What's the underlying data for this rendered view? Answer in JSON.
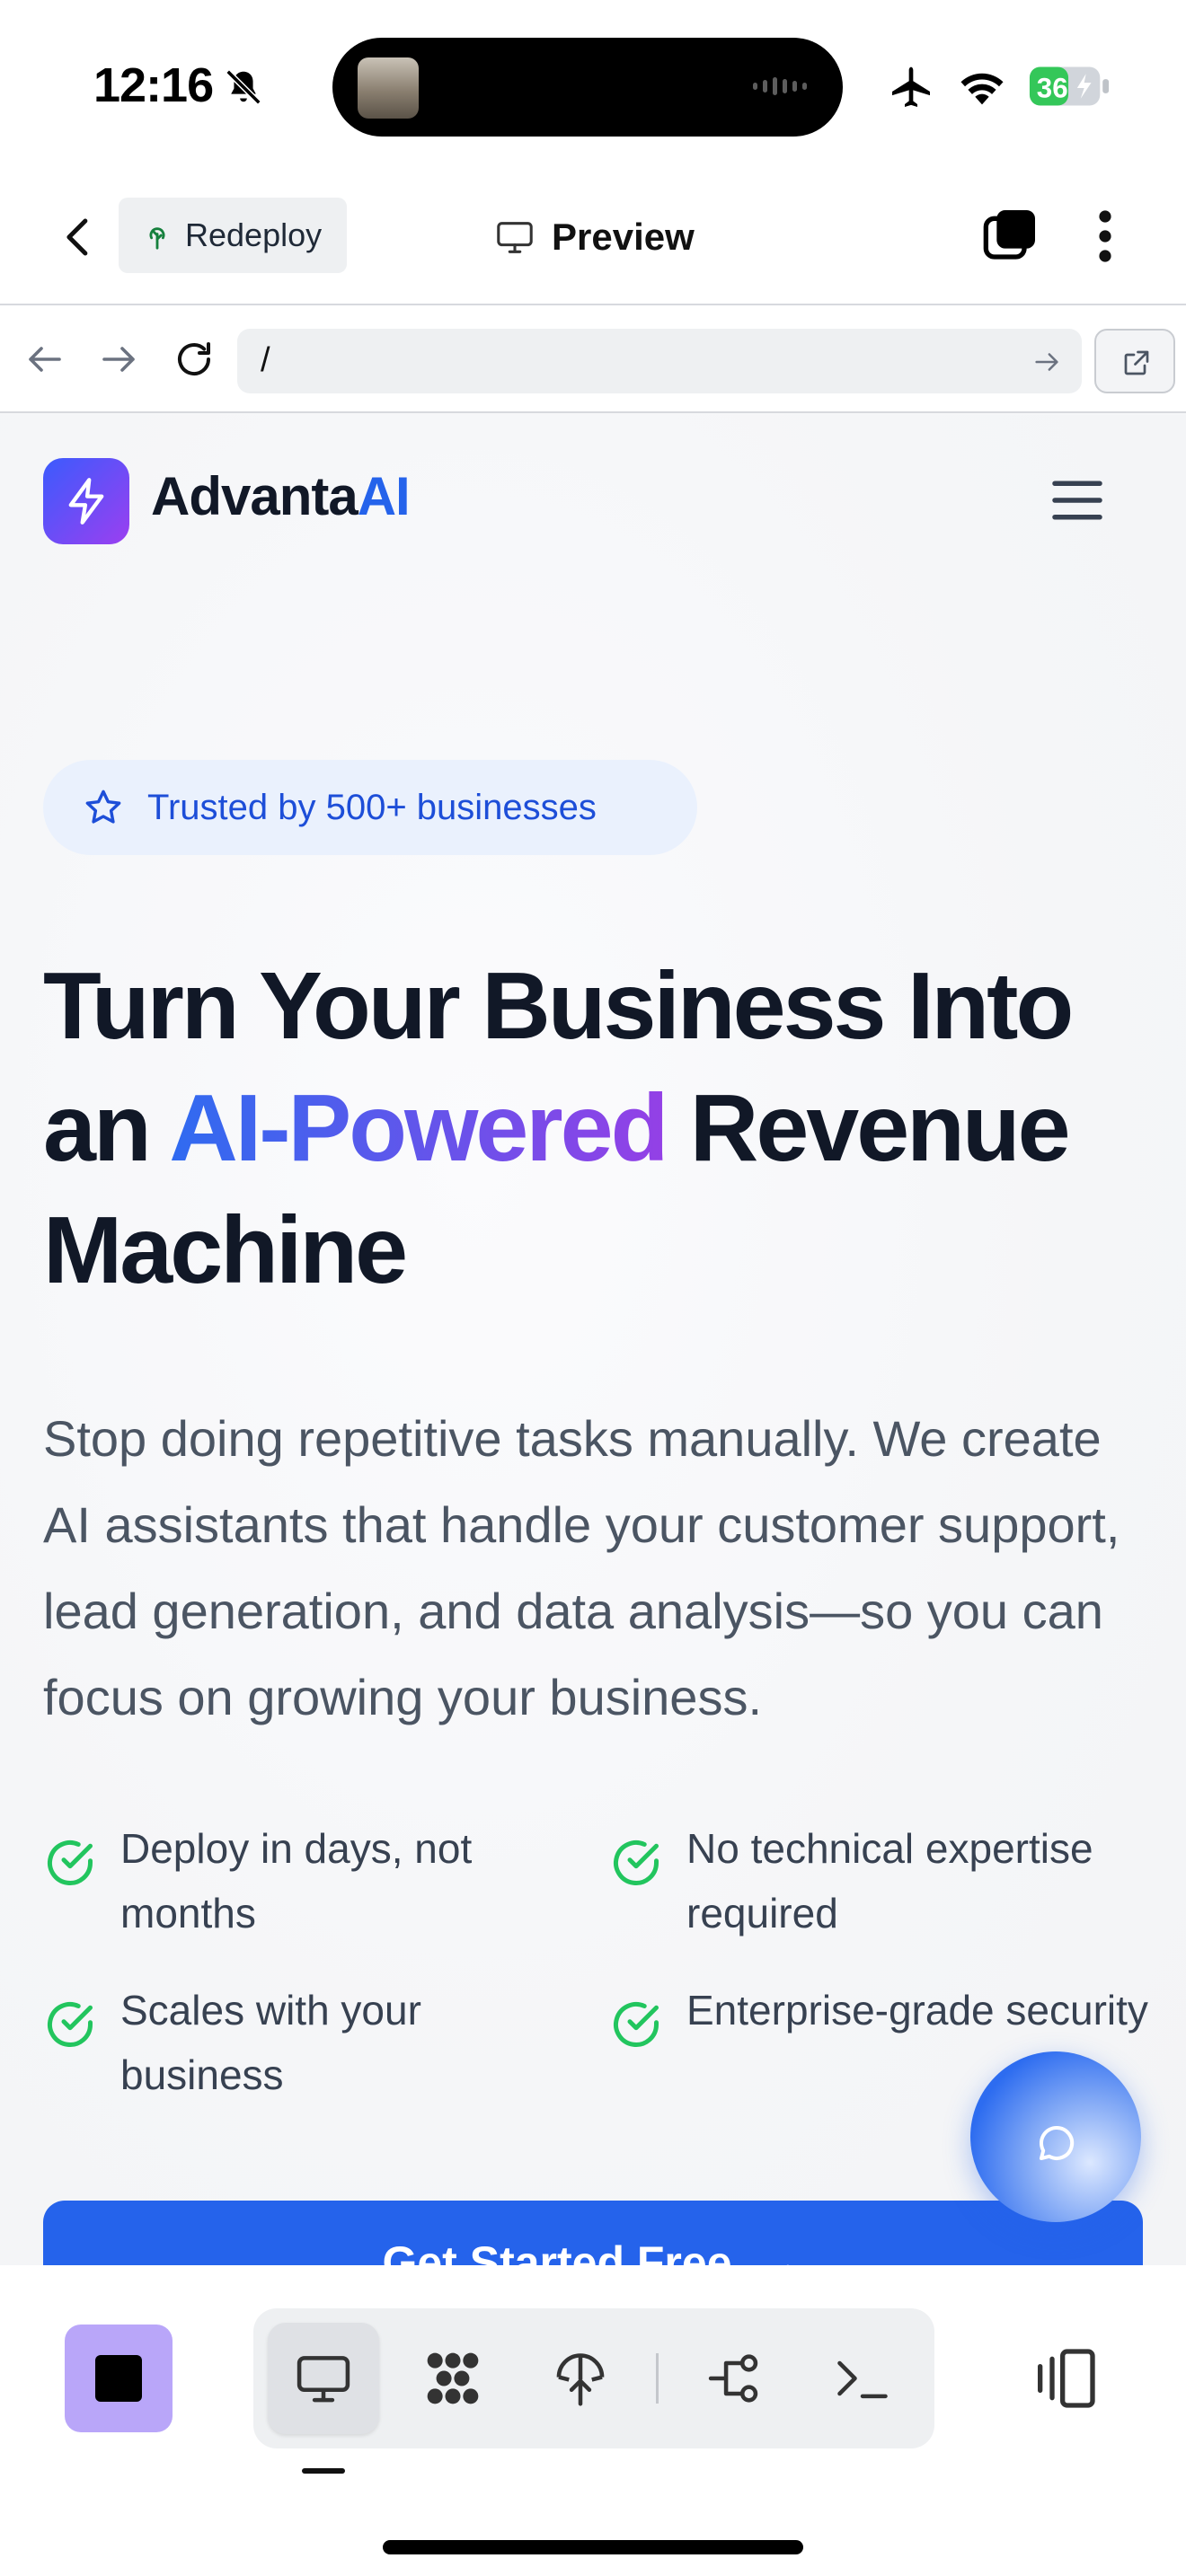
{
  "status_bar": {
    "time": "12:16",
    "battery": "36"
  },
  "app_bar": {
    "redeploy_label": "Redeploy",
    "title": "Preview"
  },
  "browser": {
    "url": "/"
  },
  "site": {
    "brand_part1": "Advanta",
    "brand_part2": "AI",
    "trust_badge": "Trusted by 500+ businesses",
    "headline": {
      "line1": "Turn Your Business Into",
      "line2_pre": "an ",
      "line2_highlight": "AI-Powered",
      "line2_post": " Revenue",
      "line3": "Machine"
    },
    "subheadline": "Stop doing repetitive tasks manually. We create AI assistants that handle your customer support, lead generation, and data analysis—so you can focus on growing your business.",
    "features": [
      "Deploy in days, not months",
      "No technical expertise required",
      "Scales with your business",
      "Enterprise-grade security"
    ],
    "cta_label": "Get Started Free",
    "cta_arrow": "→"
  },
  "colors": {
    "brand_blue": "#2563eb",
    "brand_purple": "#9440e6",
    "check_green": "#22c55e",
    "stop_button": "#b9a6f9"
  },
  "icons": {
    "toolbar": [
      "desktop-icon",
      "apps-grid-icon",
      "deploy-icon",
      "branch-icon",
      "terminal-icon"
    ]
  }
}
